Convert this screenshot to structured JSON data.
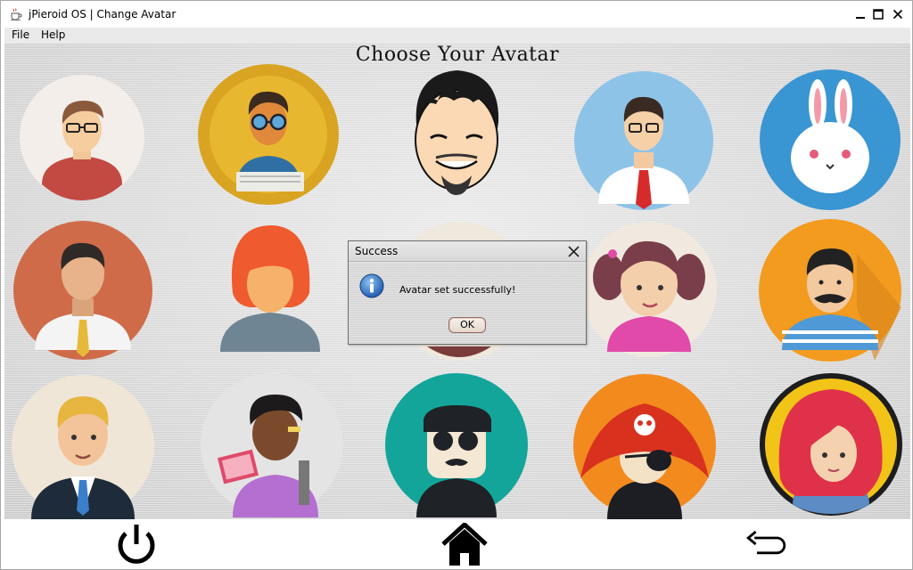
{
  "window": {
    "title": "jPieroid OS | Change Avatar"
  },
  "menubar": {
    "items": [
      "File",
      "Help"
    ]
  },
  "main": {
    "heading": "Choose Your Avatar",
    "avatars": [
      "man-glasses-red-shirt",
      "hipster-laptop",
      "cartoon-man-sketch",
      "businessman-red-tie",
      "bunny",
      "man-yellow-tie",
      "redhead-woman",
      "partially-hidden-avatar",
      "girl-pigtails",
      "mustache-sailor",
      "blond-businessman",
      "reading-student",
      "sunglasses-mustache-man",
      "pirate",
      "redhead-girl-yellow"
    ]
  },
  "dialog": {
    "title": "Success",
    "message": "Avatar set successfully!",
    "ok_label": "OK"
  },
  "bottombar": {
    "icons": [
      "power-icon",
      "home-icon",
      "back-arrow-icon"
    ]
  }
}
